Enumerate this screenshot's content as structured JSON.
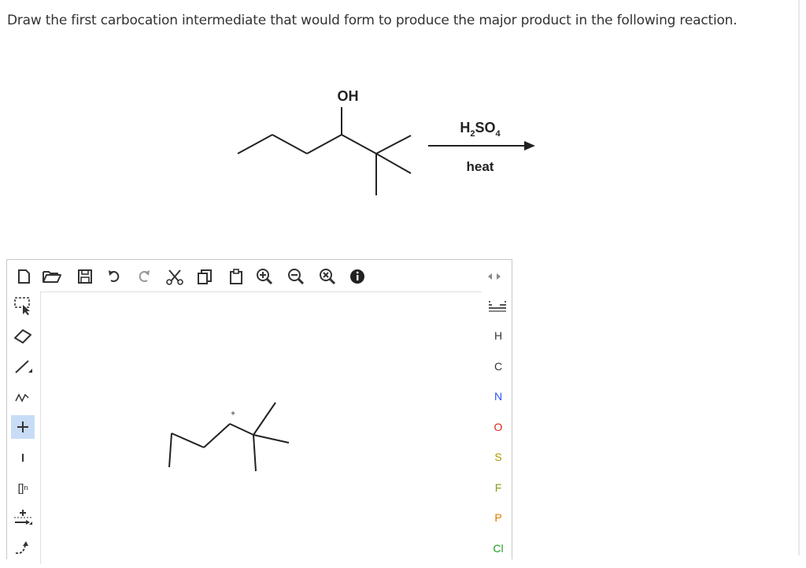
{
  "question": "Draw the first carbocation intermediate that would form to produce the major product in the following reaction.",
  "reaction": {
    "reactant_label": "OH",
    "reagent_top_parts": [
      "H",
      "2",
      "SO",
      "4"
    ],
    "reagent_bottom": "heat"
  },
  "canvas": {
    "charge_label": "+"
  },
  "atoms": [
    {
      "label": "H",
      "color": "#333333"
    },
    {
      "label": "C",
      "color": "#333333"
    },
    {
      "label": "N",
      "color": "#3050f8"
    },
    {
      "label": "O",
      "color": "#e0251b"
    },
    {
      "label": "S",
      "color": "#b39500"
    },
    {
      "label": "F",
      "color": "#8a9a1a"
    },
    {
      "label": "P",
      "color": "#e07a00"
    },
    {
      "label": "Cl",
      "color": "#1fa01f"
    }
  ],
  "left_tools": {
    "bracket_label": "[]",
    "bracket_sub": "n"
  },
  "colors": {
    "accent": "#c8dcf5",
    "border": "#c8c8c8"
  }
}
